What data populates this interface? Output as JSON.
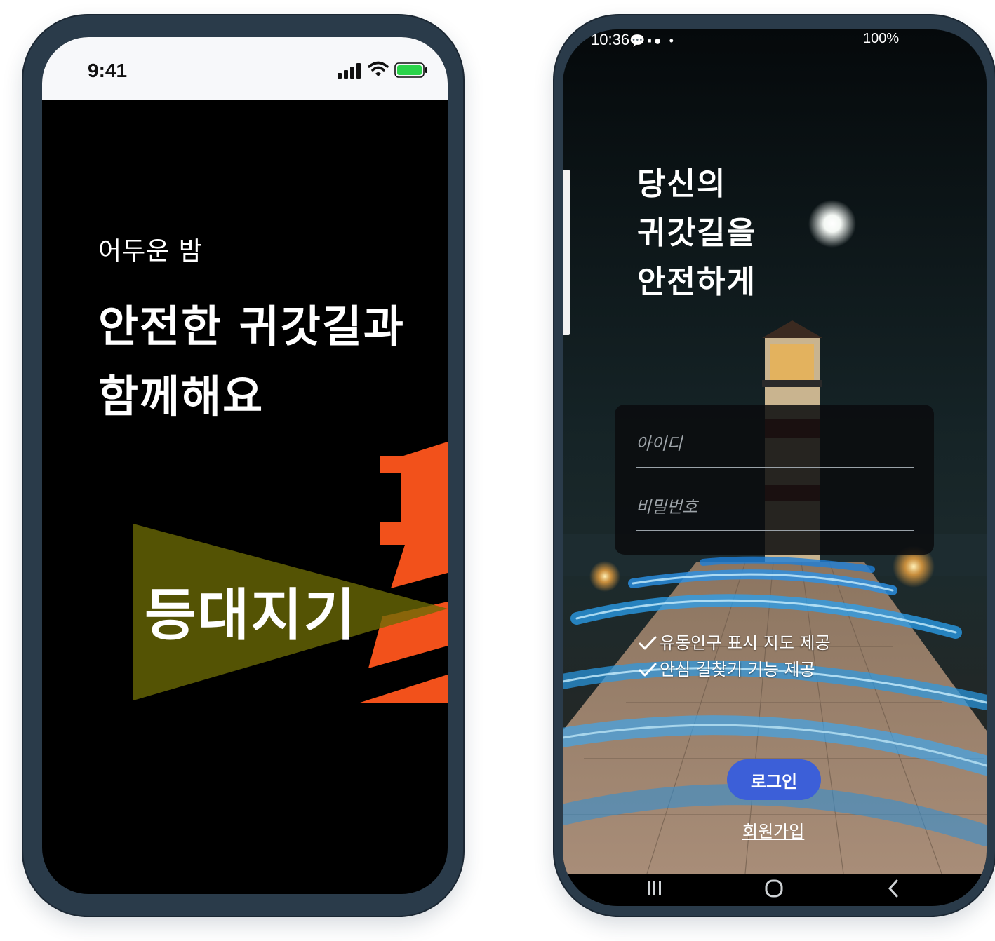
{
  "left_phone": {
    "status_bar": {
      "time": "9:41"
    },
    "tagline_small": "어두운 밤",
    "tagline_line1": "안전한 귀갓길과",
    "tagline_line2": "함께해요",
    "brand_name": "등대지기",
    "colors": {
      "accent_orange": "#f2511b",
      "beam_olive": "#4d4a05",
      "background": "#000000"
    }
  },
  "right_phone": {
    "status_bar": {
      "time": "10:36",
      "battery": "100%"
    },
    "hero_line1": "당신의",
    "hero_line2": "귀갓길을",
    "hero_line3": "안전하게",
    "login_form": {
      "id_placeholder": "아이디",
      "password_placeholder": "비밀번호"
    },
    "features": [
      "유동인구 표시 지도 제공",
      "안심 길찾기 기능 제공"
    ],
    "login_button": "로그인",
    "signup_link": "회원가입",
    "nav_bar": {
      "icons": [
        "recent-apps-icon",
        "home-icon",
        "back-icon"
      ]
    },
    "colors": {
      "button_blue": "#3c5fd8"
    }
  }
}
